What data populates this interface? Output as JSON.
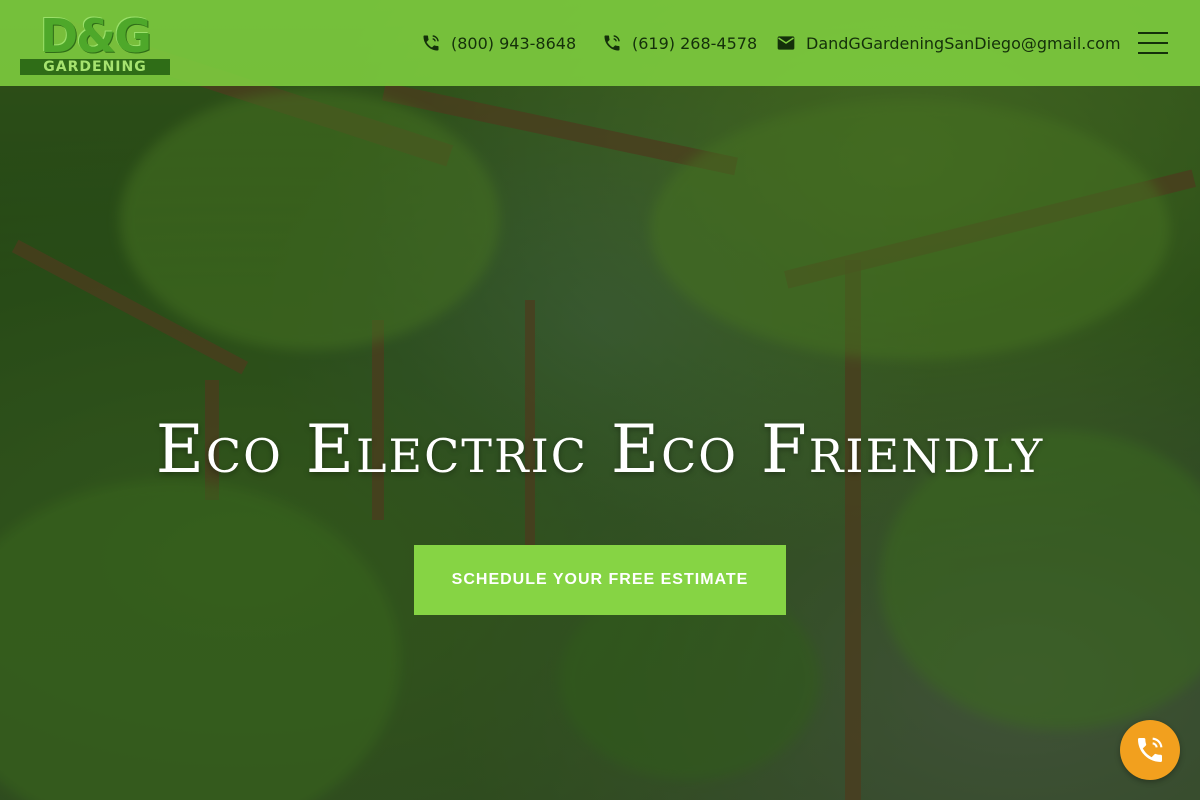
{
  "brand": {
    "logo_big": "D&G",
    "logo_sub": "GARDENING"
  },
  "header": {
    "phone_1": "(800) 943-8648",
    "phone_2": "(619) 268-4578",
    "email": "DandGGardeningSanDiego@gmail.com",
    "menu_icon": "hamburger-menu-icon"
  },
  "hero": {
    "headline": "Eco Electric Eco Friendly",
    "cta_label": "SCHEDULE YOUR FREE ESTIMATE"
  },
  "fab": {
    "icon": "phone-call-icon"
  },
  "colors": {
    "header_bg": "#80cf40",
    "cta_bg": "#86d444",
    "fab_bg": "#f2a01e",
    "header_text": "#14300a"
  }
}
